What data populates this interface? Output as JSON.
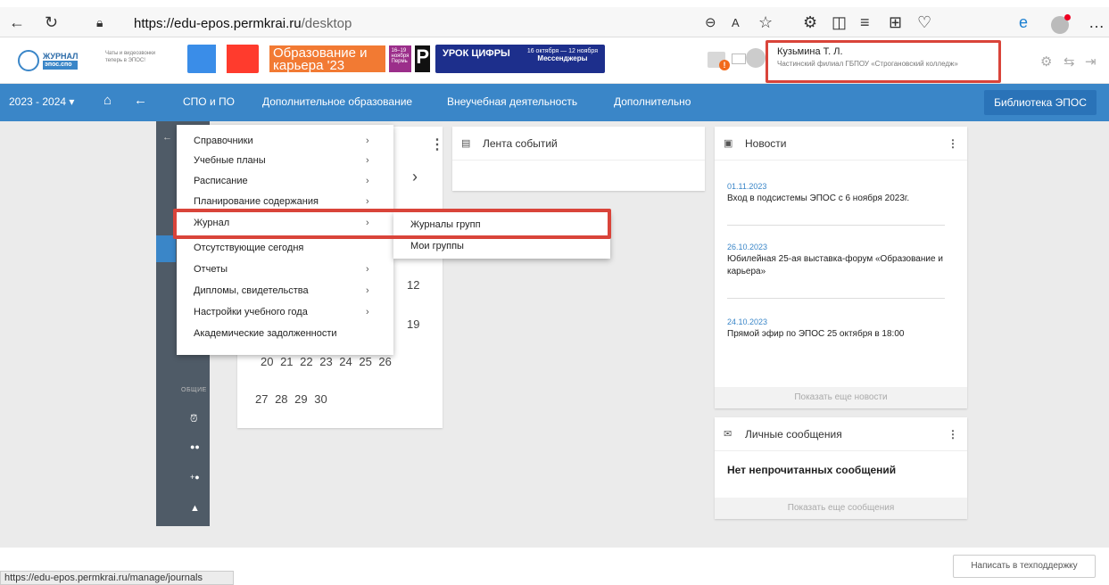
{
  "browser": {
    "url_host": "https://edu-epos.permkrai.ru",
    "url_path": "/desktop"
  },
  "header": {
    "logo_title": "ЖУРНАЛ",
    "logo_sub": "эпос.спо",
    "tagline": "Чаты и видеозвонки теперь в ЭПОС!",
    "banner_edu": "Образование и карьера '23",
    "banner_dates": "16–19 ноября Пермь",
    "banner_cifr_title": "УРОК ЦИФРЫ",
    "banner_cifr_dates": "16 октября — 12 ноября",
    "banner_cifr_topic": "Мессенджеры",
    "notif_count": "!",
    "user_name": "Кузьмина Т. Л.",
    "user_org": "Частинский филиал ГБПОУ «Строгановский колледж»"
  },
  "nav": {
    "year": "2023 - 2024",
    "items": [
      "СПО и ПО",
      "Дополнительное образование",
      "Внеучебная деятельность",
      "Дополнительно"
    ],
    "library": "Библиотека ЭПОС"
  },
  "menu": {
    "items": [
      {
        "label": "Справочники",
        "arrow": true
      },
      {
        "label": "Учебные планы",
        "arrow": true
      },
      {
        "label": "Расписание",
        "arrow": true
      },
      {
        "label": "Планирование содержания",
        "arrow": true
      },
      {
        "label": "Журнал",
        "arrow": true
      },
      {
        "label": "Отсутствующие сегодня",
        "arrow": false
      },
      {
        "label": "Отчеты",
        "arrow": true
      },
      {
        "label": "Дипломы, свидетельства",
        "arrow": true
      },
      {
        "label": "Настройки учебного года",
        "arrow": true
      },
      {
        "label": "Академические задолженности",
        "arrow": false
      }
    ],
    "sub": [
      "Журналы групп",
      "Мои группы"
    ]
  },
  "calendar": {
    "r1": "12",
    "r2": "19",
    "r3": "20 21 22 23 24 25 26",
    "r4": "27 28 29 30"
  },
  "events": {
    "title": "Лента событий"
  },
  "news": {
    "title": "Новости",
    "items": [
      {
        "date": "01.11.2023",
        "text": "Вход в подсистемы ЭПОС с 6 ноября 2023г."
      },
      {
        "date": "26.10.2023",
        "text": "Юбилейная 25-ая выставка-форум «Образование и карьера»"
      },
      {
        "date": "24.10.2023",
        "text": "Прямой эфир по ЭПОС 25 октября в 18:00"
      }
    ],
    "more": "Показать еще новости"
  },
  "messages": {
    "title": "Личные сообщения",
    "empty": "Нет непрочитанных сообщений",
    "more": "Показать еще сообщения"
  },
  "sidebar": {
    "section": "ОБЩИЕ"
  },
  "footer": {
    "status_url": "https://edu-epos.permkrai.ru/manage/journals",
    "support": "Написать в техподдержку"
  }
}
